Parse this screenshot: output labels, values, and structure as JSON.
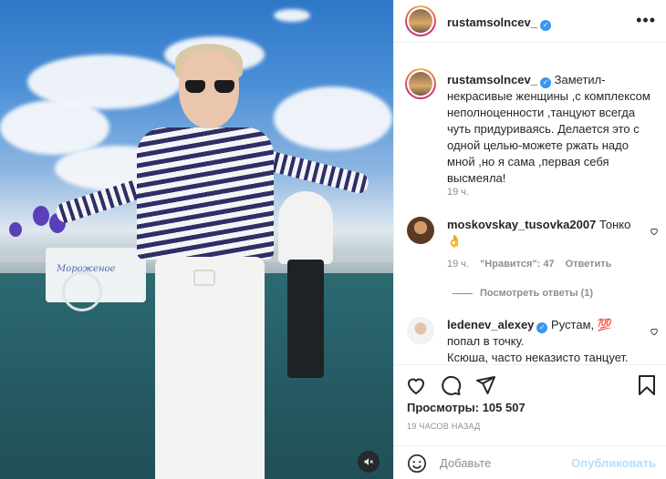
{
  "header": {
    "username": "rustamsolncev_",
    "more_label": "•••"
  },
  "caption": {
    "username": "rustamsolncev_",
    "text": "Заметил-некрасивые женщины ,с комплексом неполноценности ,танцуют всегда чуть придуриваясь. Делается это с одной целью-можете ржать надо мной ,но я сама ,первая себя высмеяла!",
    "time": "19 ч."
  },
  "comments": [
    {
      "username": "moskovskay_tusovka2007",
      "text": "Тонко 👌",
      "time": "19 ч.",
      "likes": "\"Нравится\": 47",
      "reply": "Ответить",
      "view_replies": "Посмотреть ответы (1)"
    },
    {
      "username": "ledenev_alexey",
      "text": "Рустам, 💯 попал в точку.",
      "text2": "Ксюша, часто неказисто танцует."
    }
  ],
  "stats": {
    "views": "Просмотры: 105 507",
    "ago": "19 ЧАСОВ НАЗАД"
  },
  "add_comment": {
    "placeholder": "Добавьте",
    "post_label": "Опубликовать"
  },
  "media": {
    "cart_text": "Мороженое"
  },
  "colors": {
    "verified": "#3897f0",
    "post_disabled": "#b2dffc",
    "muted": "#8e8e8e"
  }
}
